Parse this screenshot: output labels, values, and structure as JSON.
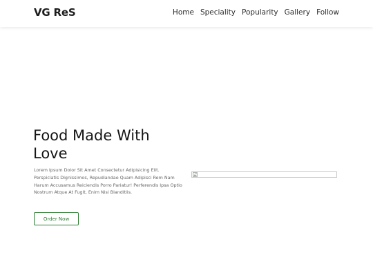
{
  "header": {
    "logo": "VG ReS",
    "nav": [
      "Home",
      "Speciality",
      "Popularity",
      "Gallery",
      "Follow"
    ]
  },
  "hero": {
    "title": "Food Made With Love",
    "text": "Lorem Ipsum Dolor Sit Amet Consectetur Adipisicing Elit. Perspiciatis Dignissimos, Repudiandae Quam Adipisci Rem Nam Harum Accusamus Reiciendis Porro Pariatur! Perferendis Ipsa Optio Nostrum Atque At Fugit, Enim Nisi Blanditiis.",
    "button": "Order Now",
    "image_icon": "broken-image-icon"
  },
  "colors": {
    "accent": "#2e7d32",
    "text": "#151515",
    "muted": "#666666"
  }
}
